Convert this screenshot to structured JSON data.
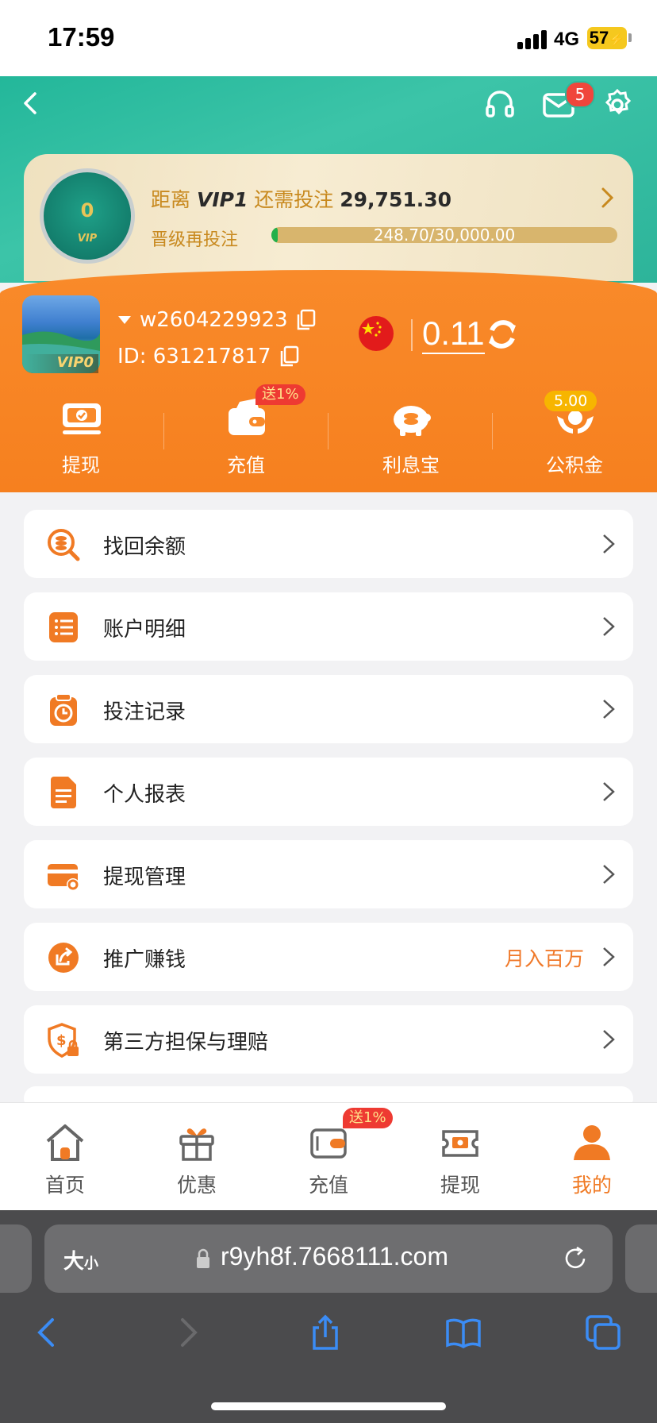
{
  "status_bar": {
    "time": "17:59",
    "network": "4G",
    "battery": "57"
  },
  "header": {
    "mail_badge": "5"
  },
  "vip": {
    "medal_level": "0",
    "medal_vip": "VIP",
    "line1_prefix": "距离",
    "target_level": "VIP1",
    "line1_mid": "还需投注",
    "remaining": "29,751.30",
    "upgrade_label": "晋级再投注",
    "progress_text": "248.70/30,000.00",
    "progress_fraction": 0.0083
  },
  "profile": {
    "avatar_badge": "VIP0",
    "username": "w2604229923",
    "id_text": "ID: 631217817",
    "balance": "0.11"
  },
  "quick_actions": [
    {
      "label": "提现",
      "icon": "withdraw-icon"
    },
    {
      "label": "充值",
      "icon": "wallet-icon",
      "badge": "送1%"
    },
    {
      "label": "利息宝",
      "icon": "piggy-bank-icon"
    },
    {
      "label": "公积金",
      "icon": "hands-coin-icon",
      "badge": "5.00"
    }
  ],
  "menu": [
    {
      "label": "找回余额",
      "icon": "search-coin-icon",
      "extra": ""
    },
    {
      "label": "账户明细",
      "icon": "list-icon",
      "extra": ""
    },
    {
      "label": "投注记录",
      "icon": "clipboard-clock-icon",
      "extra": ""
    },
    {
      "label": "个人报表",
      "icon": "document-icon",
      "extra": ""
    },
    {
      "label": "提现管理",
      "icon": "card-gear-icon",
      "extra": ""
    },
    {
      "label": "推广赚钱",
      "icon": "share-icon",
      "extra": "月入百万"
    },
    {
      "label": "第三方担保与理赔",
      "icon": "shield-lock-icon",
      "extra": ""
    }
  ],
  "tabbar": [
    {
      "label": "首页",
      "icon": "home-icon"
    },
    {
      "label": "优惠",
      "icon": "gift-icon"
    },
    {
      "label": "充值",
      "icon": "wallet-icon",
      "badge": "送1%"
    },
    {
      "label": "提现",
      "icon": "ticket-icon"
    },
    {
      "label": "我的",
      "icon": "user-icon",
      "active": true
    }
  ],
  "browser": {
    "text_size": "大",
    "text_size_small": "小",
    "url": "r9yh8f.7668111.com"
  },
  "colors": {
    "accent": "#f07a24",
    "teal": "#2db49a",
    "orange": "#f98a2a"
  }
}
